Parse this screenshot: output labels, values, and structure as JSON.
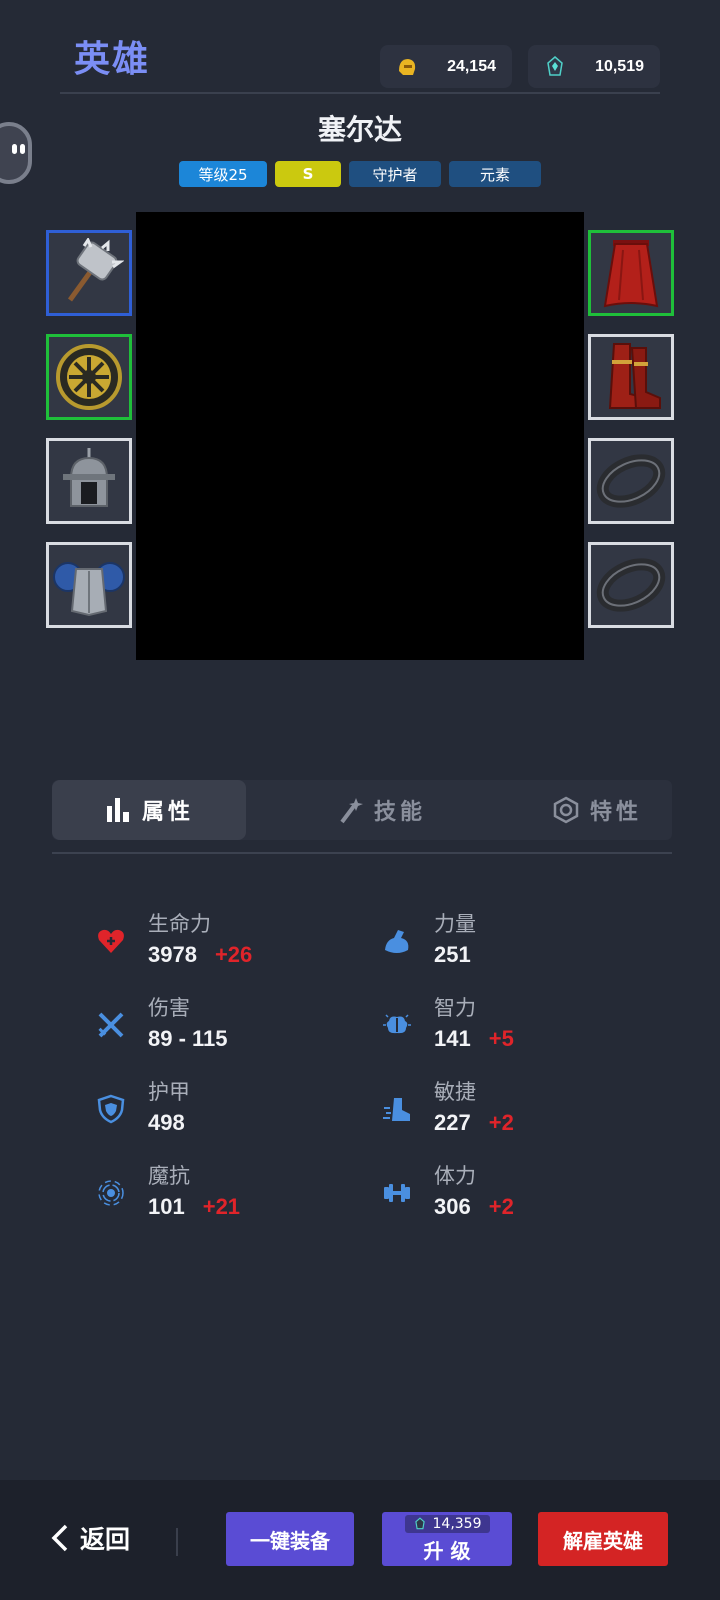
{
  "header": {
    "title": "英雄"
  },
  "resources": {
    "gold": {
      "icon": "gold-helmet-icon",
      "value": "24,154"
    },
    "gem": {
      "icon": "crystal-icon",
      "value": "10,519"
    }
  },
  "hero": {
    "name": "塞尔达",
    "tags": {
      "level": "等级25",
      "rank": "S",
      "role": "守护者",
      "element": "元素"
    }
  },
  "equipment": {
    "left": [
      "war-hammer",
      "golden-shield",
      "iron-helmet",
      "blue-pauldron-armor"
    ],
    "right": [
      "red-cape",
      "red-boots",
      "black-ring",
      "black-ring"
    ]
  },
  "tabs": {
    "attributes": "属性",
    "skills": "技能",
    "traits": "特性"
  },
  "stats": {
    "hp": {
      "label": "生命力",
      "value": "3978",
      "bonus": "+26"
    },
    "strength": {
      "label": "力量",
      "value": "251",
      "bonus": ""
    },
    "damage": {
      "label": "伤害",
      "value": "89 - 115",
      "bonus": ""
    },
    "intellect": {
      "label": "智力",
      "value": "141",
      "bonus": "+5"
    },
    "armor": {
      "label": "护甲",
      "value": "498",
      "bonus": ""
    },
    "agility": {
      "label": "敏捷",
      "value": "227",
      "bonus": "+2"
    },
    "magic_resist": {
      "label": "魔抗",
      "value": "101",
      "bonus": "+21"
    },
    "stamina": {
      "label": "体力",
      "value": "306",
      "bonus": "+2"
    }
  },
  "footer": {
    "back_label": "返回",
    "equip_all_label": "一键装备",
    "upgrade_label": "升 级",
    "upgrade_cost": "14,359",
    "hire_label": "解雇英雄"
  },
  "colors": {
    "accent": "#7b8ef5",
    "bonus": "#e0242a",
    "button": "#5a4cd4",
    "danger": "#d42424"
  }
}
